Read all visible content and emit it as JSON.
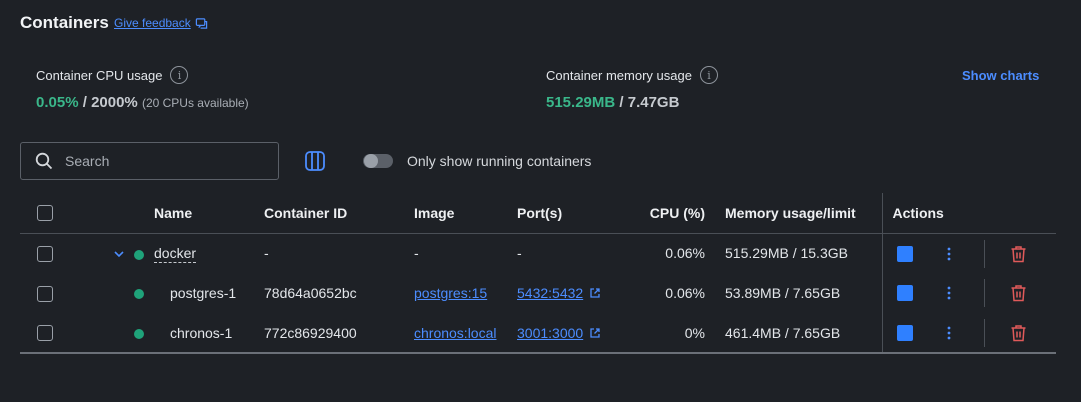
{
  "header": {
    "title": "Containers",
    "feedback_label": "Give feedback"
  },
  "stats": {
    "cpu": {
      "label": "Container CPU usage",
      "used": "0.05%",
      "separator": " / ",
      "total": "2000%",
      "note": "(20 CPUs available)"
    },
    "memory": {
      "label": "Container memory usage",
      "used": "515.29MB",
      "separator": " / ",
      "total": "7.47GB"
    },
    "show_charts_label": "Show charts"
  },
  "toolbar": {
    "search_placeholder": "Search",
    "toggle_label": "Only show running containers",
    "toggle_on": false
  },
  "table": {
    "columns": {
      "name": "Name",
      "container_id": "Container ID",
      "image": "Image",
      "ports": "Port(s)",
      "cpu": "CPU (%)",
      "memory": "Memory usage/limit",
      "actions": "Actions"
    },
    "rows": [
      {
        "name": "docker",
        "container_id": "-",
        "image": "-",
        "ports": "-",
        "cpu": "0.06%",
        "memory": "515.29MB / 15.3GB"
      },
      {
        "name": "postgres-1",
        "container_id": "78d64a0652bc",
        "image": "postgres:15",
        "ports": "5432:5432",
        "cpu": "0.06%",
        "memory": "53.89MB / 7.65GB"
      },
      {
        "name": "chronos-1",
        "container_id": "772c86929400",
        "image": "chronos:local",
        "ports": "3001:3000",
        "cpu": "0%",
        "memory": "461.4MB / 7.65GB"
      }
    ]
  },
  "colors": {
    "background": "#1e2126",
    "accent": "#4c8dff",
    "running_green": "#1fa37a",
    "stat_green": "#3ab78a",
    "delete_red": "#e05a5a"
  }
}
